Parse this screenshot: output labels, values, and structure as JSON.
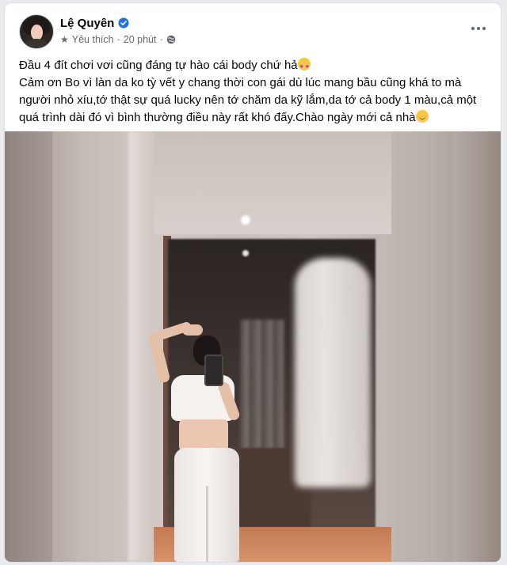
{
  "post": {
    "author": {
      "name": "Lệ Quyên",
      "verified": true
    },
    "meta": {
      "tag": "Yêu thích",
      "separator": "·",
      "time": "20 phút",
      "audience_icon": "globe-icon",
      "tag_icon": "star-icon"
    },
    "more_icon": "more-options-icon",
    "text": {
      "line1": "Đầu 4 đít chơi vơi cũng đáng tự hào cái body chứ hả",
      "line1_emoji": "star-struck-emoji",
      "line2": "Cảm ơn Bo vì làn da ko tỳ vết y chang thời con gái dù lúc mang bầu cũng khá to mà người nhỏ xíu,tớ thật sự quá lucky nên tớ chăm da kỹ lắm,da tớ cả body 1 màu,cả một quá trình dài đó vì bình thường điều này rất khó đấy.Chào ngày mới cả nhà",
      "line2_emoji": "smiling-face-emoji"
    },
    "photo": {
      "description_icon": "mirror-selfie-photo"
    }
  },
  "colors": {
    "verified_blue": "#1b74e4",
    "secondary_text": "#65676b",
    "primary_text": "#050505"
  }
}
